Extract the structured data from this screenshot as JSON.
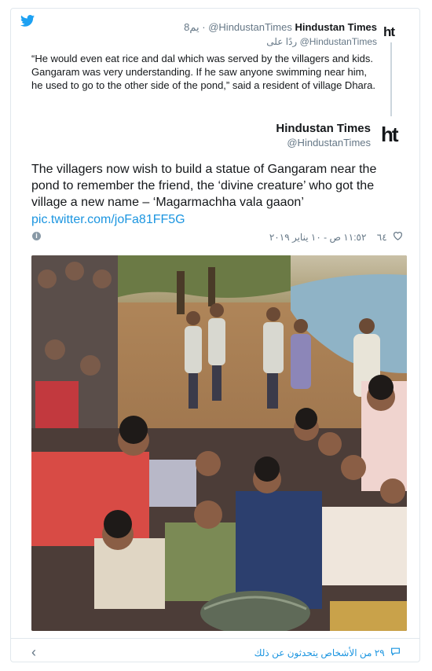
{
  "quoted": {
    "name": "Hindustan Times",
    "handle": "@HindustanTimes",
    "time": "8يم ·",
    "reply_prefix": "ردًا على",
    "reply_handle": "@HindustanTimes",
    "logo": "ht",
    "text": "“He would even eat rice and dal which was served by the villagers and kids. Gangaram was very understanding. If he saw anyone swimming near him, he used to go to the other side of the pond,” said a resident of village Dhara."
  },
  "tweet": {
    "name": "Hindustan Times",
    "handle": "@HindustanTimes",
    "logo": "ht",
    "text": "The villagers now wish to build a statue of Gangaram near the pond to remember the friend, the ‘divine creature’ who got the village a new name – ‘Magarmachha vala gaaon’",
    "link": "pic.twitter.com/joFa81FF5G",
    "likes": "٦٤",
    "datetime": "١١:٥٢ ص - ١٠ يناير ٢٠١٩"
  },
  "footer": {
    "people_talking": "٢٩ من الأشخاص يتحدثون عن ذلك"
  },
  "icons": {
    "bird": "twitter-bird-icon",
    "heart": "heart-icon",
    "info": "info-icon",
    "chevron": "chevron-left-icon",
    "comment": "comment-bubble-icon"
  },
  "colors": {
    "link": "#1b95e0",
    "muted": "#657786",
    "border": "#e1e8ed"
  }
}
